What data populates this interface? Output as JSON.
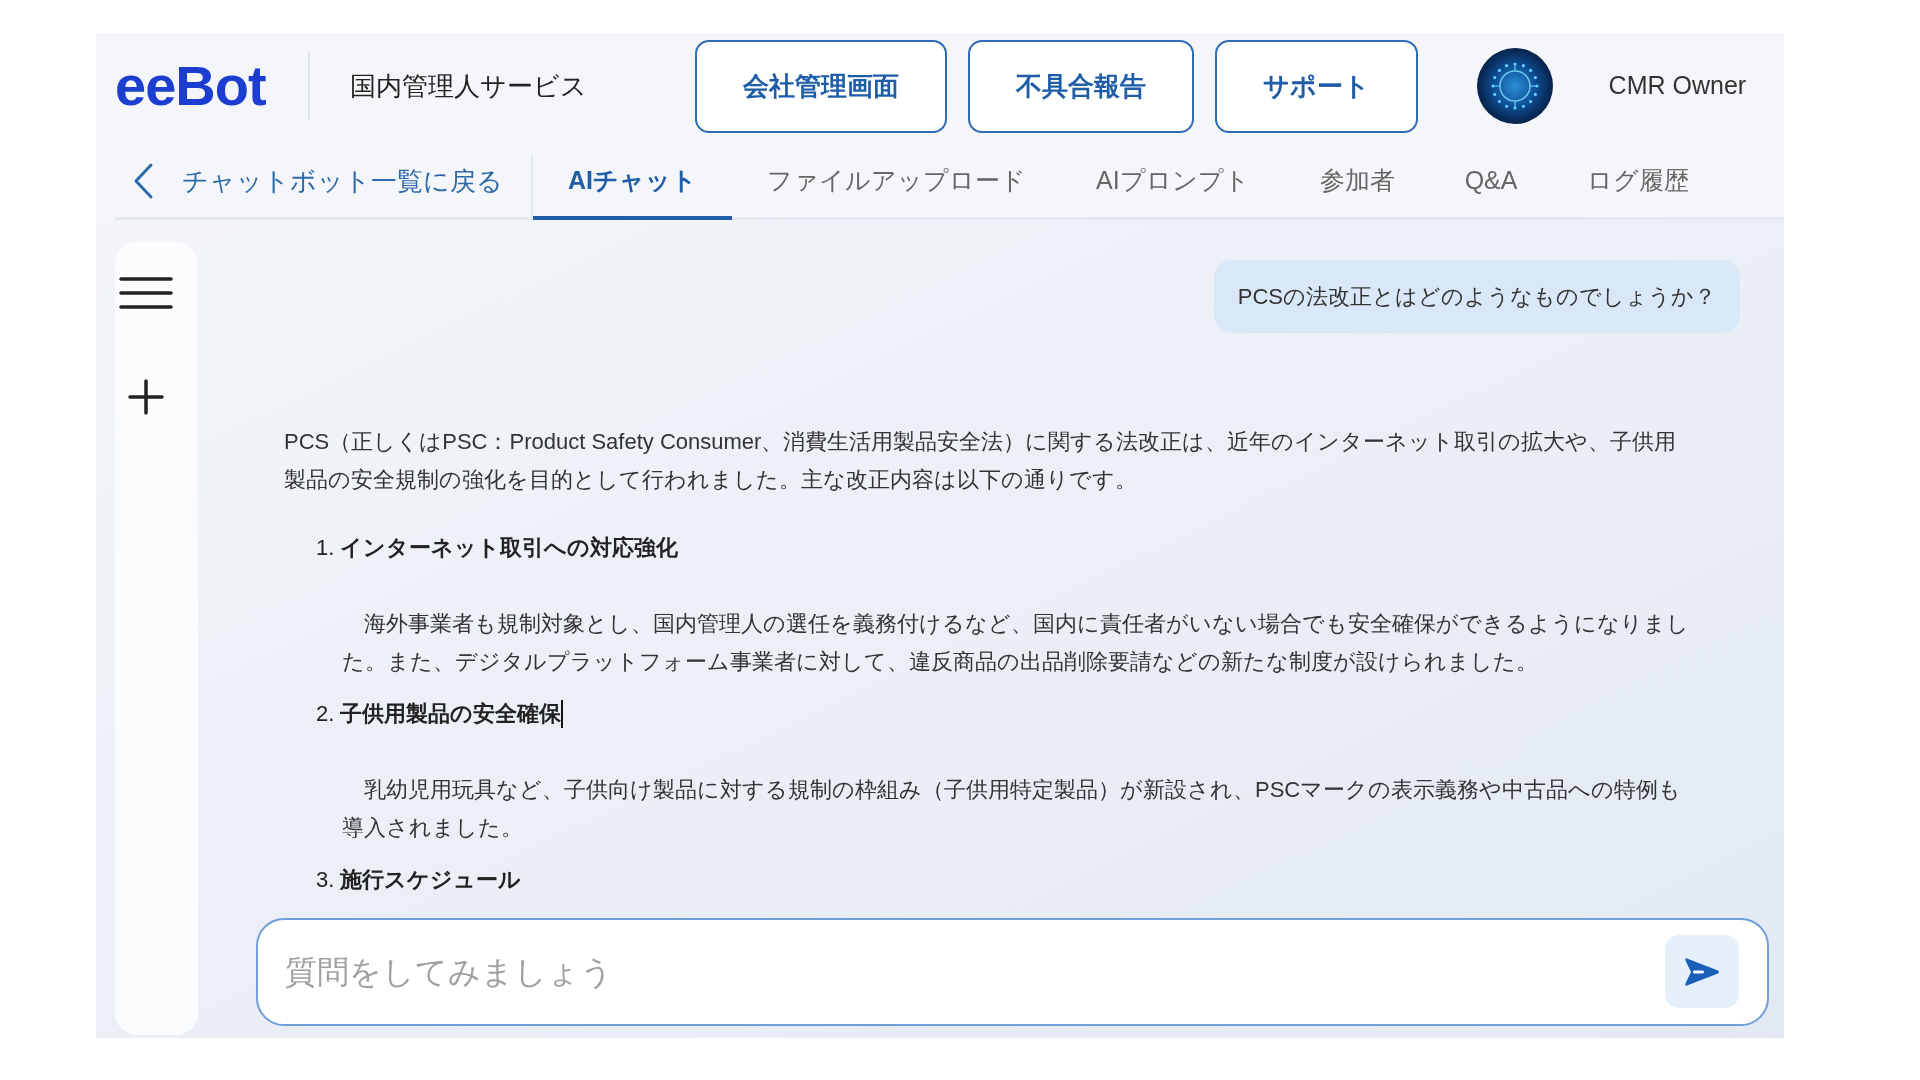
{
  "header": {
    "logo": "eeBot",
    "service_name": "国内管理人サービス",
    "buttons": [
      "会社管理画面",
      "不具合報告",
      "サポート"
    ],
    "user": {
      "name": "CMR Owner"
    }
  },
  "nav": {
    "back_link": "チャットボット一覧に戻る",
    "tabs": [
      {
        "label": "AIチャット",
        "selected": true
      },
      {
        "label": "ファイルアップロード",
        "selected": false
      },
      {
        "label": "AIプロンプト",
        "selected": false
      },
      {
        "label": "参加者",
        "selected": false
      },
      {
        "label": "Q&A",
        "selected": false
      },
      {
        "label": "ログ履歴",
        "selected": false
      }
    ]
  },
  "chat": {
    "messages": [
      {
        "kind": "user",
        "text": "PCSの法改正とはどのようなものでしょうか？"
      },
      {
        "kind": "assistant",
        "intro": "PCS（正しくはPSC：Product Safety Consumer、消費生活用製品安全法）に関する法改正は、近年のインターネット取引の拡大や、子供用製品の安全規制の強化を目的として行われました。主な改正内容は以下の通りです。",
        "sections": [
          {
            "number": "1.",
            "heading": "インターネット取引への対応強化",
            "body": "海外事業者も規制対象とし、国内管理人の選任を義務付けるなど、国内に責任者がいない場合でも安全確保ができるようになりました。また、デジタルプラットフォーム事業者に対して、違反商品の出品削除要請などの新たな制度が設けられました。",
            "cursor": false
          },
          {
            "number": "2.",
            "heading": "子供用製品の安全確保",
            "body": "乳幼児用玩具など、子供向け製品に対する規制の枠組み（子供用特定製品）が新設され、PSCマークの表示義務や中古品への特例も導入されました。",
            "cursor": true
          },
          {
            "number": "3.",
            "heading": "施行スケジュール",
            "cursor": false
          }
        ]
      }
    ],
    "input": {
      "placeholder": "質問をしてみましょう"
    }
  }
}
